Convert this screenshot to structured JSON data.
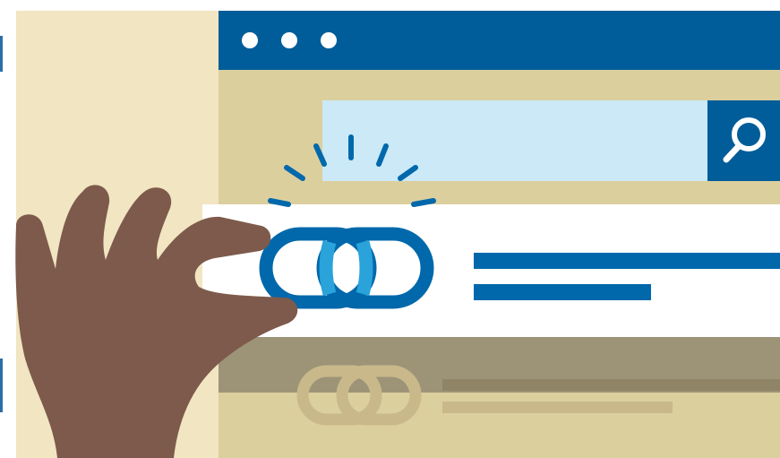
{
  "colors": {
    "page_background": "#f1e5c2",
    "browser_body": "#dccf9e",
    "titlebar": "#015d99",
    "search_field": "#cbe9f7",
    "link_blue": "#0068ab",
    "link_light": "#29a3da",
    "hand": "#7d5a4b",
    "ghost_link": "#c9b98a",
    "shadow": "#9d9478"
  },
  "icons": {
    "window_dots": "three-dots-icon",
    "search": "magnifier-icon",
    "link": "chain-link-icon",
    "sparkle": "shine-lines-icon",
    "hand": "pinching-hand-icon"
  }
}
